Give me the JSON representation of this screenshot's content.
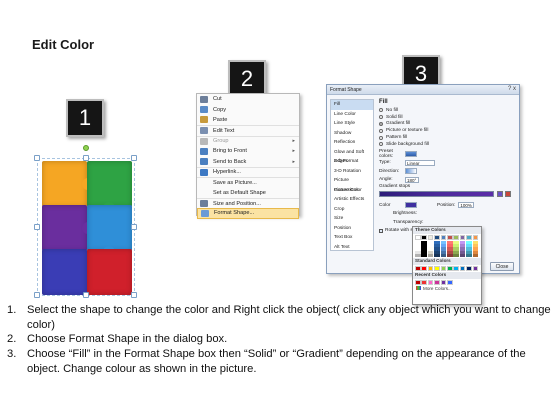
{
  "title": "Edit Color",
  "badges": [
    "1",
    "2",
    "3"
  ],
  "puzzle_colors": [
    "#f5a623",
    "#2ea344",
    "#6a2e9e",
    "#2f8fd8",
    "#3a3db5",
    "#d0202b"
  ],
  "context_menu": {
    "items": [
      {
        "label": "Cut",
        "icon": "scissors-icon",
        "color": "#6d7f9a",
        "arrow": false,
        "dim": false
      },
      {
        "label": "Copy",
        "icon": "copy-icon",
        "color": "#5a8bc7",
        "arrow": false,
        "dim": false
      },
      {
        "label": "Paste",
        "icon": "paste-icon",
        "color": "#c79a3c",
        "arrow": false,
        "dim": false
      },
      {
        "label": "Edit Text",
        "icon": "edit-text-icon",
        "color": "#7a8fb0",
        "arrow": false,
        "dim": false
      },
      {
        "label": "Group",
        "icon": "group-icon",
        "color": "#b8b8b8",
        "arrow": true,
        "dim": true
      },
      {
        "label": "Bring to Front",
        "icon": "bring-front-icon",
        "color": "#4a7fc0",
        "arrow": true,
        "dim": false
      },
      {
        "label": "Send to Back",
        "icon": "send-back-icon",
        "color": "#4a7fc0",
        "arrow": true,
        "dim": false
      },
      {
        "label": "Hyperlink...",
        "icon": "hyperlink-icon",
        "color": "#3d79c4",
        "arrow": false,
        "dim": false
      },
      {
        "label": "Save as Picture...",
        "icon": "",
        "color": "",
        "arrow": false,
        "dim": false
      },
      {
        "label": "Set as Default Shape",
        "icon": "",
        "color": "",
        "arrow": false,
        "dim": false
      },
      {
        "label": "Size and Position...",
        "icon": "size-position-icon",
        "color": "#6d7f9a",
        "arrow": false,
        "dim": false
      },
      {
        "label": "Format Shape...",
        "icon": "format-shape-icon",
        "color": "#6b9ad6",
        "arrow": false,
        "dim": false
      }
    ]
  },
  "format_dialog": {
    "title": "Format Shape",
    "close": "?  x",
    "nav": [
      "Fill",
      "Line Color",
      "Line Style",
      "Shadow",
      "Reflection",
      "Glow and Soft Edges",
      "3-D Format",
      "3-D Rotation",
      "Picture Corrections",
      "Picture Color",
      "Artistic Effects",
      "Crop",
      "Size",
      "Position",
      "Text Box",
      "Alt Text"
    ],
    "fill_heading": "Fill",
    "options": [
      "No fill",
      "Solid fill",
      "Gradient fill",
      "Picture or texture fill",
      "Pattern fill",
      "Slide background fill"
    ],
    "selected_option": 2,
    "preset_label": "Preset colors:",
    "type_label": "Type:",
    "type_value": "Linear",
    "direction_label": "Direction:",
    "angle_label": "Angle:",
    "angle_value": "180°",
    "stops_label": "Gradient stops",
    "color_label": "Color",
    "position_label": "Position:",
    "position_value": "100%",
    "brightness_label": "Brightness:",
    "transparency_label": "Transparency:",
    "rotate_label": "Rotate with shape",
    "close_button": "Close"
  },
  "color_picker": {
    "theme_header": "Theme Colors",
    "theme_colors": [
      "#ffffff",
      "#000000",
      "#eeece1",
      "#1f497d",
      "#4f81bd",
      "#c0504d",
      "#9bbb59",
      "#8064a2",
      "#4bacc6",
      "#f79646"
    ],
    "standard_header": "Standard Colors",
    "standard_colors": [
      "#c00000",
      "#ff0000",
      "#ffc000",
      "#ffff00",
      "#92d050",
      "#00b050",
      "#00b0f0",
      "#0070c0",
      "#002060",
      "#7030a0"
    ],
    "recent_header": "Recent Colors",
    "recent_colors": [
      "#c00000",
      "#e33",
      "#ff66cc",
      "#cc3399",
      "#7030a0",
      "#3366ff"
    ],
    "more_label": "More Colors..."
  },
  "steps": [
    {
      "n": "1.",
      "text": "Select the shape to change the color and Right click the object( click any object which you want to change color)"
    },
    {
      "n": "2.",
      "text": "Choose Format Shape in the dialog box."
    },
    {
      "n": "3.",
      "text": "Choose “Fill” in the Format Shape box then “Solid” or “Gradient” depending on the appearance of the object. Change colour as shown in the picture."
    }
  ]
}
